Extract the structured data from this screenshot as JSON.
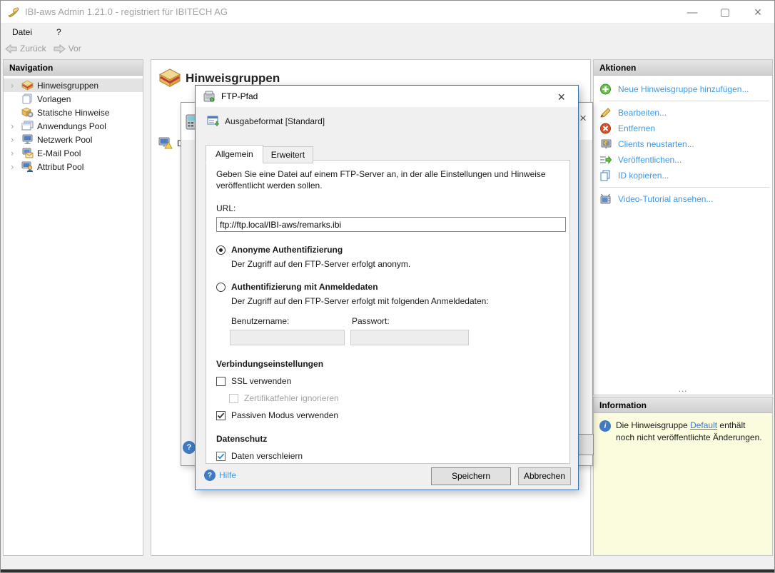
{
  "window": {
    "title": "IBI-aws Admin 1.21.0 - registriert für IBITECH AG"
  },
  "icons": {
    "window_minimize": "—",
    "window_maximize": "▢",
    "window_close": "×",
    "dialog_close": "×",
    "bg_dialog_close": "×",
    "nav_chevron": "›",
    "splitter_ellipsis": "…",
    "help_glyph": "?",
    "info_glyph": "i"
  },
  "menu": {
    "file": "Datei",
    "help": "?"
  },
  "toolbar": {
    "back": "Zurück",
    "forward": "Vor"
  },
  "navigation": {
    "header": "Navigation",
    "items": [
      {
        "label": "Hinweisgruppen",
        "icon": "notice-groups-icon",
        "expandable": true,
        "selected": true
      },
      {
        "label": "Vorlagen",
        "icon": "templates-icon",
        "expandable": false,
        "selected": false
      },
      {
        "label": "Statische Hinweise",
        "icon": "static-notices-icon",
        "expandable": false,
        "selected": false
      },
      {
        "label": "Anwendungs Pool",
        "icon": "application-pool-icon",
        "expandable": true,
        "selected": false
      },
      {
        "label": "Netzwerk Pool",
        "icon": "network-pool-icon",
        "expandable": true,
        "selected": false
      },
      {
        "label": "E-Mail Pool",
        "icon": "email-pool-icon",
        "expandable": true,
        "selected": false
      },
      {
        "label": "Attribut Pool",
        "icon": "attribute-pool-icon",
        "expandable": true,
        "selected": false
      }
    ]
  },
  "main": {
    "title": "Hinweisgruppen",
    "partial_row_label": "D"
  },
  "dialog": {
    "title": "FTP-Pfad",
    "format_label": "Ausgabeformat [Standard]",
    "tabs": [
      {
        "label": "Allgemein",
        "active": true
      },
      {
        "label": "Erweitert",
        "active": false
      }
    ],
    "description": "Geben Sie eine Datei auf einem FTP-Server an, in der alle Einstellungen und Hinweise veröffentlicht werden sollen.",
    "url": {
      "label": "URL:",
      "value": "ftp://ftp.local/IBI-aws/remarks.ibi"
    },
    "auth": {
      "anonymous": {
        "label": "Anonyme Authentifizierung",
        "description": "Der Zugriff auf den FTP-Server erfolgt anonym.",
        "selected": true
      },
      "credentials": {
        "label": "Authentifizierung mit Anmeldedaten",
        "description": "Der Zugriff auf den FTP-Server erfolgt mit folgenden Anmeldedaten:",
        "selected": false,
        "username_label": "Benutzername:",
        "password_label": "Passwort:",
        "username_value": "",
        "password_value": ""
      }
    },
    "connection": {
      "header": "Verbindungseinstellungen",
      "ssl": {
        "label": "SSL verwenden",
        "checked": false,
        "enabled": true
      },
      "cert": {
        "label": "Zertifikatfehler ignorieren",
        "checked": false,
        "enabled": false
      },
      "passive": {
        "label": "Passiven Modus verwenden",
        "checked": true,
        "enabled": true
      }
    },
    "privacy": {
      "header": "Datenschutz",
      "obfuscate": {
        "label": "Daten verschleiern",
        "checked": true,
        "enabled": true
      }
    },
    "footer": {
      "help_label": "Hilfe",
      "save_label": "Speichern",
      "cancel_label": "Abbrechen"
    }
  },
  "actions": {
    "header": "Aktionen",
    "items": [
      {
        "label": "Neue Hinweisgruppe hinzufügen...",
        "icon": "add-icon"
      },
      {
        "label": "Bearbeiten...",
        "icon": "edit-icon"
      },
      {
        "label": "Entfernen",
        "icon": "remove-icon"
      },
      {
        "label": "Clients neustarten...",
        "icon": "restart-clients-icon"
      },
      {
        "label": "Veröffentlichen...",
        "icon": "publish-icon"
      },
      {
        "label": "ID kopieren...",
        "icon": "copy-id-icon"
      },
      {
        "label": "Video-Tutorial ansehen...",
        "icon": "video-tutorial-icon"
      }
    ]
  },
  "information": {
    "header": "Information",
    "text_before": "Die Hinweisgruppe ",
    "link": "Default",
    "text_after": " enthält noch nicht veröffentlichte Änderungen."
  },
  "colors": {
    "action_link": "#3c99e8",
    "info_link": "#3b78c3",
    "modal_border": "#3a72a8",
    "info_bg": "#fbfbde",
    "checkbox_blue": "#1a7fd4"
  }
}
